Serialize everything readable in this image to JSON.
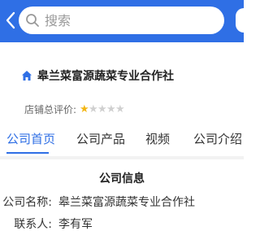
{
  "search": {
    "placeholder": "搜索"
  },
  "icons": {
    "back": "chevron-left-icon",
    "search": "search-icon",
    "home": "home-icon",
    "star": "star-icon"
  },
  "colors": {
    "brand": "#2f6fe5",
    "star_filled": "#f3b614",
    "star_empty": "#d0d0d0"
  },
  "shop": {
    "name": "皋兰菜富源蔬菜专业合作社",
    "rating_label": "店铺总评价:",
    "rating": 1,
    "rating_max": 5
  },
  "tabs": [
    {
      "label": "公司首页",
      "active": true
    },
    {
      "label": "公司产品",
      "active": false
    },
    {
      "label": "视频",
      "active": false
    },
    {
      "label": "公司介绍",
      "active": false
    }
  ],
  "company_info": {
    "title": "公司信息",
    "rows": [
      {
        "label": "公司名称:",
        "value": "皋兰菜富源蔬菜专业合作社"
      },
      {
        "label": "联系人:",
        "value": "李有军"
      }
    ]
  }
}
